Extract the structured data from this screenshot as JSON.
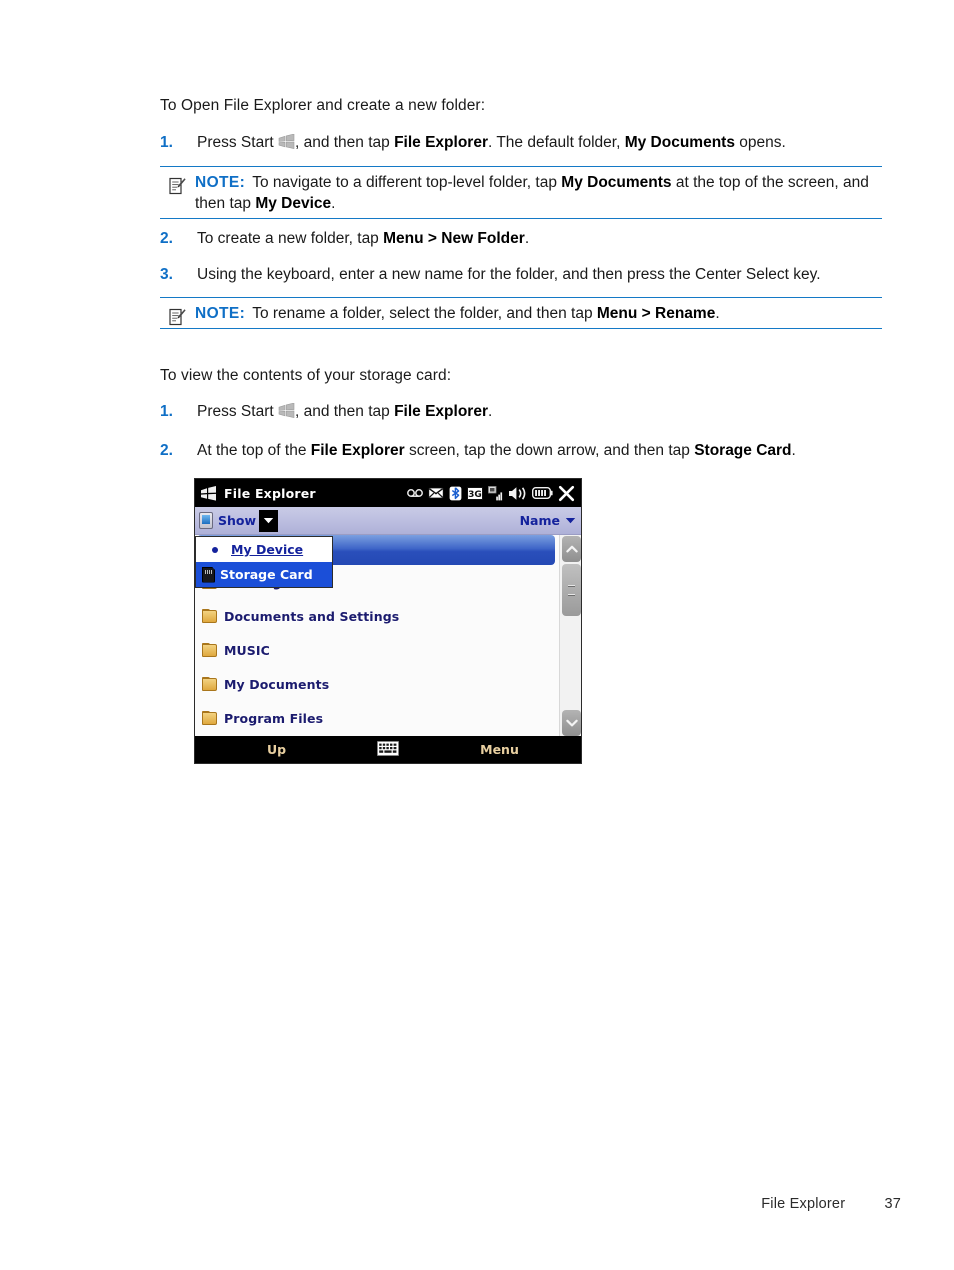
{
  "document": {
    "section_1": {
      "intro": "To Open File Explorer and create a new folder:",
      "steps": [
        {
          "number": "1.",
          "parts": [
            "Press Start ",
            "",
            ", and then tap ",
            "File Explorer",
            ". The default folder, ",
            "My Documents",
            " opens."
          ]
        },
        {
          "number": "2.",
          "parts": [
            "To create a new folder, tap ",
            "Menu > New Folder",
            "."
          ]
        },
        {
          "number": "3.",
          "parts": [
            "Using the keyboard, enter a new name for the folder, and then press the Center Select key."
          ]
        }
      ],
      "note_1": {
        "label": "NOTE:",
        "text_a": "To navigate to a different top-level folder, tap ",
        "bold_a": "My Documents",
        "text_b": " at the top of the screen, and then tap ",
        "bold_b": "My Device",
        "text_c": "."
      },
      "note_2": {
        "label": "NOTE:",
        "text_a": "To rename a folder, select the folder, and then tap ",
        "bold_a": "Menu > Rename",
        "text_b": "."
      }
    },
    "section_2": {
      "intro": "To view the contents of your storage card:",
      "steps": [
        {
          "number": "1.",
          "parts": [
            "Press Start ",
            "",
            ", and then tap ",
            "File Explorer",
            "."
          ]
        },
        {
          "number": "2.",
          "parts": [
            "At the top of the ",
            "File Explorer",
            " screen, tap the down arrow, and then tap ",
            "Storage Card",
            "."
          ]
        }
      ]
    },
    "footer": {
      "chapter": "File Explorer",
      "page_number": "37"
    }
  },
  "device_screenshot": {
    "titlebar": {
      "title": "File Explorer",
      "start_icon": "windows-flag-icon",
      "status_icons": [
        "voicemail-icon",
        "message-envelope-icon",
        "bluetooth-icon",
        "3g-icon",
        "signal-strength-icon",
        "volume-speaker-icon",
        "battery-icon",
        "close-x-icon"
      ],
      "3g_label": "3G"
    },
    "toolbar": {
      "show_label": "Show",
      "show_icon": "pda-device-icon",
      "dropdown_arrow": "chevron-down-icon",
      "sort_label": "Name",
      "sort_arrow": "chevron-down-icon"
    },
    "dropdown": {
      "items": [
        {
          "label": "My Device",
          "icon": "bullet-dot",
          "selected": false
        },
        {
          "label": "Storage Card",
          "icon": "sd-card-icon",
          "selected": true
        }
      ]
    },
    "file_list": {
      "rows": [
        {
          "label": "",
          "icon": "folder-icon",
          "selected": true
        },
        {
          "label": "ConnMgr",
          "icon": "folder-icon",
          "selected": false
        },
        {
          "label": "Documents and Settings",
          "icon": "folder-icon",
          "selected": false
        },
        {
          "label": "MUSIC",
          "icon": "folder-icon",
          "selected": false
        },
        {
          "label": "My Documents",
          "icon": "folder-icon",
          "selected": false
        },
        {
          "label": "Program Files",
          "icon": "folder-icon",
          "selected": false
        }
      ],
      "scrollbar": {
        "up_icon": "chevron-up-icon",
        "down_icon": "chevron-down-icon",
        "thumb": "scroll-thumb"
      }
    },
    "softkeys": {
      "left": "Up",
      "center_icon": "keyboard-icon",
      "right": "Menu"
    }
  },
  "colors": {
    "accent_blue": "#0f6fc6",
    "note_rule": "#1479c6",
    "device_title_bg": "#000000",
    "device_toolbar_bg": "#bcbee0",
    "device_toolbar_text": "#14229c",
    "list_text": "#1b1b6e",
    "selection_blue": "#2a4fbb",
    "dropdown_selection": "#1b4fd8",
    "softkey_text": "#e8cfa0",
    "folder_gold": "#dfa83e"
  }
}
